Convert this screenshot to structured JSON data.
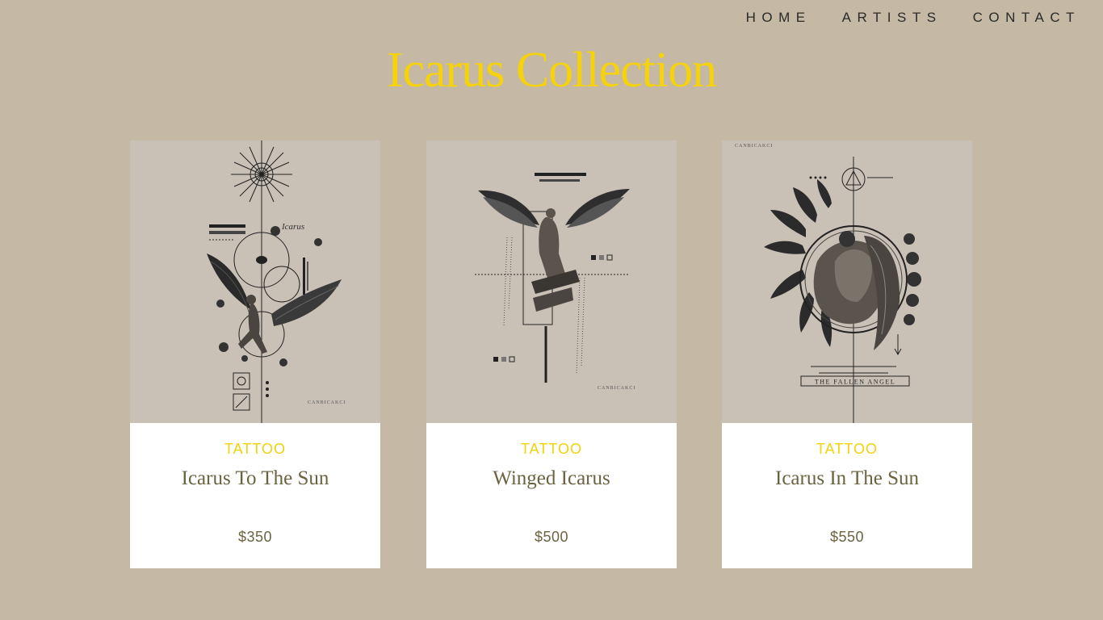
{
  "nav": {
    "items": [
      {
        "label": "HOME"
      },
      {
        "label": "ARTISTS"
      },
      {
        "label": "CONTACT"
      }
    ]
  },
  "page": {
    "title": "Icarus Collection"
  },
  "products": [
    {
      "category": "TATTOO",
      "name": "Icarus To The Sun",
      "price": "$350",
      "art_text": "CANBICAKCI",
      "art_script": "Icarus"
    },
    {
      "category": "TATTOO",
      "name": "Winged Icarus",
      "price": "$500",
      "art_text": "CANBICAKCI"
    },
    {
      "category": "TATTOO",
      "name": "Icarus In The Sun",
      "price": "$550",
      "art_text": "CANBICAKCI",
      "art_banner": "THE FALLEN ANGEL"
    }
  ],
  "colors": {
    "background": "#c5b9a5",
    "title": "#f5d20a",
    "category": "#f0d30a",
    "product_text": "#6b6340",
    "card": "#ffffff",
    "art_paper": "#c9c1b6"
  }
}
